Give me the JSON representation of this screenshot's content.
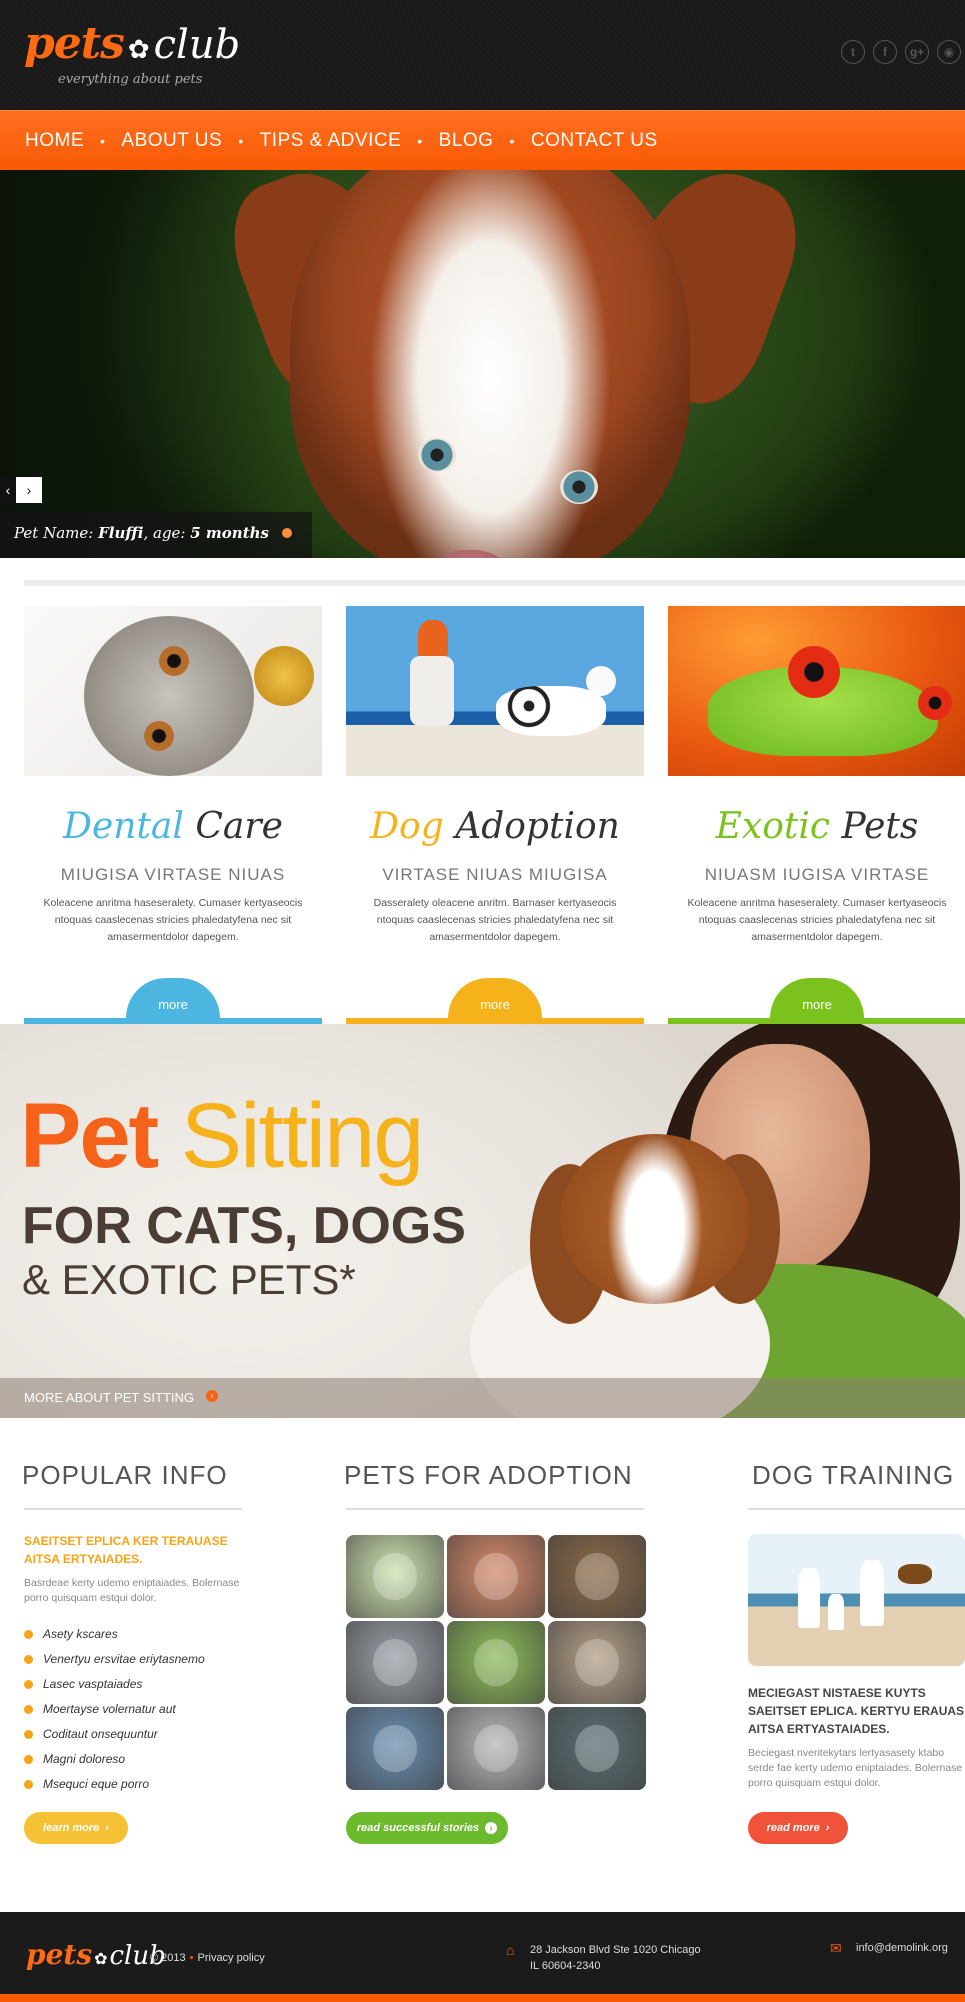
{
  "header": {
    "logo_word1": "pets",
    "logo_word2": "club",
    "tagline": "everything about pets",
    "social": [
      "t",
      "f",
      "g+",
      "rss"
    ]
  },
  "nav": {
    "items": [
      "HOME",
      "ABOUT US",
      "TIPS & ADVICE",
      "BLOG",
      "CONTACT US"
    ]
  },
  "hero": {
    "caption_label": "Pet Name:",
    "pet_name": "Fluffi",
    "age_label": ", age:",
    "age": "5 months"
  },
  "features": [
    {
      "title_colored": "Dental",
      "title_rest": " Care",
      "color": "#4cb6e0",
      "subtitle": "MIUGISA VIRTASE NIUAS",
      "text": "Koleacene anritma haseseralety. Cumaser kertyaseocis ntoquas caaslecenas stricies phaledatyfena nec sit amasermentdolor dapegem.",
      "more": "more"
    },
    {
      "title_colored": "Dog",
      "title_rest": " Adoption",
      "color": "#f5b21b",
      "subtitle": "VIRTASE NIUAS MIUGISA",
      "text": "Dasseralety oleacene anritm. Barnaser kertyaseocis ntoquas caaslecenas stricies phaledatyfena nec sit amasermentdolor dapegem.",
      "more": "more"
    },
    {
      "title_colored": "Exotic",
      "title_rest": " Pets",
      "color": "#7cc21e",
      "subtitle": "NIUASM IUGISA VIRTASE",
      "text": "Koleacene anritma haseseralety. Cumaser kertyaseocis ntoquas caaslecenas stricies phaledatyfena nec sit amasermentdolor dapegem.",
      "more": "more"
    }
  ],
  "banner": {
    "word1": "Pet",
    "word2": "Sitting",
    "line2": "FOR CATS, DOGS",
    "line3": "& EXOTIC PETS*",
    "link": "MORE ABOUT PET SITTING"
  },
  "popular": {
    "title": "POPULAR INFO",
    "subtitle": "SAEITSET EPLICA KER TERAUASE AITSA ERTYAIADES.",
    "text": "Basrdeae kerty udemo eniptaiades. Bolernase porro quisquam estqui dolor.",
    "list": [
      "Asety kscares",
      "Venertyu ersvitae eriytasnemo",
      "Lasec vasptaiades",
      "Moertayse volernatur aut",
      "Coditaut onsequuntur",
      "Magni doloreso",
      "Msequci eque porro"
    ],
    "button": "learn more"
  },
  "adoption": {
    "title": "PETS FOR ADOPTION",
    "button": "read successful stories",
    "tiles": [
      "#cfe3b0",
      "#d88a6a",
      "#8c6a48",
      "#9aa0a8",
      "#8fbf5a",
      "#b5a088",
      "#6a8fb2",
      "#b8b8bc",
      "#5b6f73"
    ]
  },
  "training": {
    "title": "DOG TRAINING",
    "subtitle": "MECIEGAST NISTAESE KUYTS SAEITSET EPLICA. KERTYU ERAUAS AITSA ERTYASTAIADES.",
    "text": "Beciegast nveritekytars lertyasasety ktabo serde fae kerty udemo eniptaiades. Bolernase porro quisquam estqui dolor.",
    "button": "read more"
  },
  "footer": {
    "logo_word1": "pets",
    "logo_word2": "club",
    "year": "© 2013",
    "policy": "Privacy policy",
    "address_line1": "28 Jackson Blvd Ste 1020 Chicago",
    "address_line2": "IL 60604-2340",
    "email": "info@demolink.org"
  },
  "colors": {
    "orange": "#f85a05",
    "yellow": "#f5b21b",
    "blue": "#4cb6e0",
    "green": "#7cc21e",
    "red": "#f0533a"
  }
}
